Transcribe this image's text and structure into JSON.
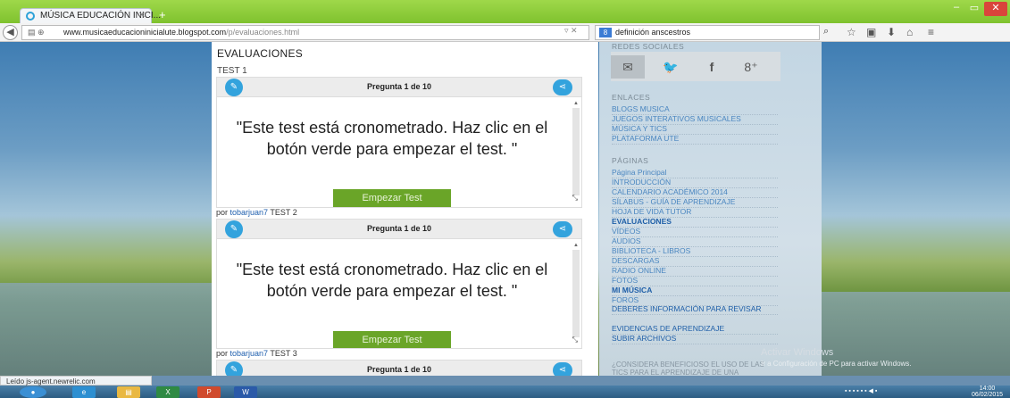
{
  "browser": {
    "tab_title": "MÚSICA EDUCACIÓN INICI...",
    "url_domain": "www.musicaeducacioninicialute.blogspot.com",
    "url_path": "/p/evaluaciones.html",
    "search_query": "definición anscestros",
    "status_text": "Leído js-agent.newrelic.com"
  },
  "main": {
    "title": "EVALUACIONES",
    "tests": [
      {
        "label": "TEST 1",
        "question": "Pregunta 1 de 10",
        "message": "\"Este test está cronometrado. Haz clic en el botón verde para empezar el test. \"",
        "start_button": "Empezar Test",
        "byline_prefix": "por",
        "author": "tobarjuan7",
        "next_label": "TEST 2"
      },
      {
        "label": "TEST 2",
        "question": "Pregunta 1 de 10",
        "message": "\"Este test está cronometrado. Haz clic en el botón verde para empezar el test. \"",
        "start_button": "Empezar Test",
        "byline_prefix": "por",
        "author": "tobarjuan7",
        "next_label": "TEST 3"
      },
      {
        "label": "TEST 3",
        "question": "Pregunta 1 de 10"
      }
    ]
  },
  "sidebar": {
    "social_heading": "REDES SOCIALES",
    "social_icons": [
      "email-icon",
      "twitter-icon",
      "facebook-icon",
      "google-plus-icon"
    ],
    "links_heading": "ENLACES",
    "links": [
      "BLOGS MUSICA",
      "JUEGOS INTERATIVOS MUSICALES",
      "MÚSICA Y TICS",
      "PLATAFORMA UTE"
    ],
    "pages_heading": "PÁGINAS",
    "pages": [
      "Página Principal",
      "INTRODUCCIÓN",
      "CALENDARIO ACADÉMICO 2014",
      "SÍLABUS - GUÍA DE APRENDIZAJE",
      "HOJA DE VIDA TUTOR",
      "EVALUACIONES",
      "VÍDEOS",
      "AUDIOS",
      "BIBLIOTECA - LIBROS",
      "DESCARGAS",
      "RADIO ONLINE",
      "FOTOS",
      "MI MÚSICA",
      "FOROS",
      "DEBERES INFORMACIÓN PARA REVISAR",
      "EVIDENCIAS DE APRENDIZAJE",
      "SUBIR ARCHIVOS"
    ],
    "active_page": "EVALUACIONES",
    "poll_question": "¿CONSIDERA BENEFICIOSO EL USO DE LAS TICS PARA EL APRENDIZAJE DE UNA ASIGNATURA?"
  },
  "watermark": {
    "title": "Activar Windows",
    "subtitle": "Ir a Configuración de PC para activar Windows."
  },
  "taskbar": {
    "clock_time": "14:00",
    "clock_date": "06/02/2015"
  }
}
